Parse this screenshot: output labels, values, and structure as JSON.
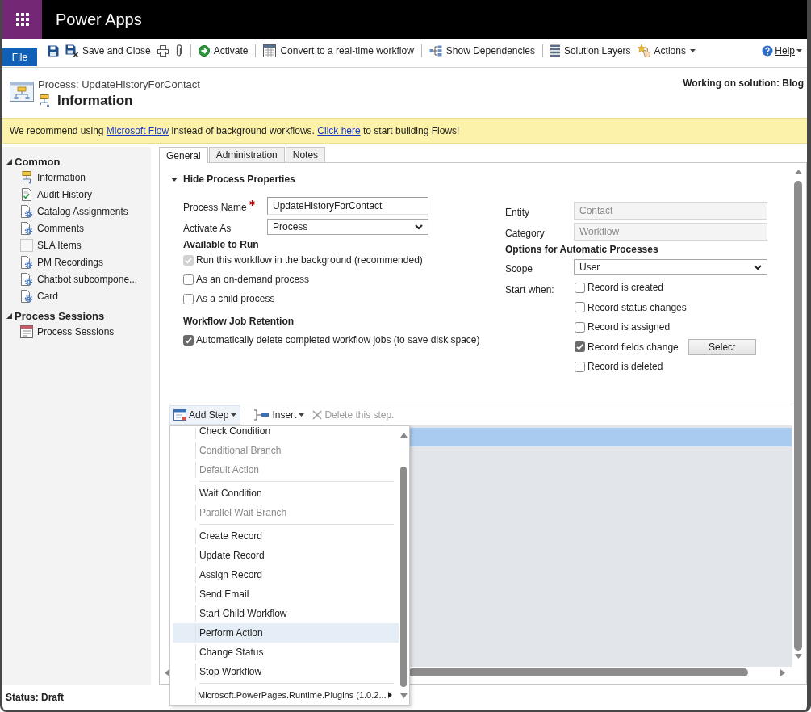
{
  "app_bar": {
    "title": "Power Apps"
  },
  "ribbon": {
    "file_tab": "File",
    "commands": [
      {
        "label": "Save and Close",
        "dropdown": false
      },
      {
        "label": "Activate",
        "dropdown": false
      },
      {
        "label": "Convert to a real-time workflow",
        "dropdown": false
      },
      {
        "label": "Show Dependencies",
        "dropdown": false
      },
      {
        "label": "Solution Layers",
        "dropdown": false
      },
      {
        "label": "Actions",
        "dropdown": true
      }
    ],
    "help": {
      "label": "Help",
      "dropdown": true
    }
  },
  "record": {
    "type_label": "Process: UpdateHistoryForContact",
    "title": "Information",
    "solution": "Working on solution: Blog"
  },
  "notice": {
    "parts": [
      {
        "kind": "text",
        "text": "We recommend using "
      },
      {
        "kind": "link",
        "text": "Microsoft Flow"
      },
      {
        "kind": "text",
        "text": " instead of background workflows. "
      },
      {
        "kind": "link",
        "text": "Click here"
      },
      {
        "kind": "text",
        "text": " to start building Flows!"
      }
    ]
  },
  "sidebar": {
    "sections": [
      {
        "title": "Common",
        "expanded": true,
        "items": [
          {
            "label": "Information"
          },
          {
            "label": "Audit History"
          },
          {
            "label": "Catalog Assignments"
          },
          {
            "label": "Comments"
          },
          {
            "label": "SLA Items"
          },
          {
            "label": "PM Recordings"
          },
          {
            "label": "Chatbot subcompone..."
          },
          {
            "label": "Card"
          }
        ]
      },
      {
        "title": "Process Sessions",
        "expanded": true,
        "items": [
          {
            "label": "Process Sessions"
          }
        ]
      }
    ]
  },
  "form": {
    "tabs": [
      {
        "label": "General",
        "selected": true
      },
      {
        "label": "Administration",
        "selected": false
      },
      {
        "label": "Notes",
        "selected": false
      }
    ],
    "toggle": {
      "label": "Hide Process Properties",
      "expanded": true
    },
    "fields": [
      {
        "kind": "text",
        "label": "Process Name",
        "required": true,
        "value": "UpdateHistoryForContact",
        "disabled": false
      },
      {
        "kind": "select",
        "label": "Activate As",
        "required": false,
        "value": "Process",
        "disabled": false
      }
    ],
    "available_to_run": {
      "heading": "Available to Run",
      "options": [
        {
          "label": "Run this workflow in the background (recommended)",
          "checked": true,
          "disabled": true
        },
        {
          "label": "As an on-demand process",
          "checked": false,
          "disabled": false
        },
        {
          "label": "As a child process",
          "checked": false,
          "disabled": false
        }
      ]
    },
    "job_retention": {
      "heading": "Workflow Job Retention",
      "options": [
        {
          "label": "Automatically delete completed workflow jobs (to save disk space)",
          "checked": true,
          "disabled": false
        }
      ]
    },
    "entity_fields": [
      {
        "kind": "text",
        "label": "Entity",
        "required": false,
        "value": "Contact",
        "disabled": true
      },
      {
        "kind": "text",
        "label": "Category",
        "required": false,
        "value": "Workflow",
        "disabled": true
      }
    ],
    "automatic": {
      "heading": "Options for Automatic Processes",
      "fields": [
        {
          "kind": "select",
          "label": "Scope",
          "required": false,
          "value": "User",
          "disabled": false
        }
      ],
      "start_when": {
        "label": "Start when:",
        "options": [
          {
            "label": "Record is created",
            "checked": false
          },
          {
            "label": "Record status changes",
            "checked": false
          },
          {
            "label": "Record is assigned",
            "checked": false
          },
          {
            "label": "Record fields change",
            "checked": true,
            "button": "Select"
          },
          {
            "label": "Record is deleted",
            "checked": false
          }
        ]
      }
    }
  },
  "steps": {
    "toolbar": [
      {
        "label": "Add Step",
        "dropdown": true,
        "disabled": false,
        "expanded": true,
        "menu": {
          "groups": [
            {
              "items": [
                {
                  "label": "Check Condition",
                  "disabled": false,
                  "selected": false,
                  "submenu": false
                },
                {
                  "label": "Conditional Branch",
                  "disabled": true,
                  "selected": false,
                  "submenu": false
                },
                {
                  "label": "Default Action",
                  "disabled": true,
                  "selected": false,
                  "submenu": false
                }
              ]
            },
            {
              "items": [
                {
                  "label": "Wait Condition",
                  "disabled": false,
                  "selected": false,
                  "submenu": false
                },
                {
                  "label": "Parallel Wait Branch",
                  "disabled": true,
                  "selected": false,
                  "submenu": false
                }
              ]
            },
            {
              "items": [
                {
                  "label": "Create Record",
                  "disabled": false,
                  "selected": false,
                  "submenu": false
                },
                {
                  "label": "Update Record",
                  "disabled": false,
                  "selected": false,
                  "submenu": false
                },
                {
                  "label": "Assign Record",
                  "disabled": false,
                  "selected": false,
                  "submenu": false
                },
                {
                  "label": "Send Email",
                  "disabled": false,
                  "selected": false,
                  "submenu": false
                },
                {
                  "label": "Start Child Workflow",
                  "disabled": false,
                  "selected": false,
                  "submenu": false
                },
                {
                  "label": "Perform Action",
                  "disabled": false,
                  "selected": true,
                  "submenu": false
                },
                {
                  "label": "Change Status",
                  "disabled": false,
                  "selected": false,
                  "submenu": false
                },
                {
                  "label": "Stop Workflow",
                  "disabled": false,
                  "selected": false,
                  "submenu": false
                }
              ]
            },
            {
              "items": [
                {
                  "label": "Microsoft.PowerPages.Runtime.Plugins (1.0.2...",
                  "disabled": false,
                  "selected": false,
                  "submenu": true
                }
              ]
            }
          ]
        }
      },
      {
        "label": "Insert",
        "dropdown": true,
        "disabled": false,
        "expanded": false
      },
      {
        "label": "Delete this step.",
        "dropdown": false,
        "disabled": true,
        "expanded": false
      }
    ],
    "step_selected": true
  },
  "status_bar": "Status: Draft"
}
